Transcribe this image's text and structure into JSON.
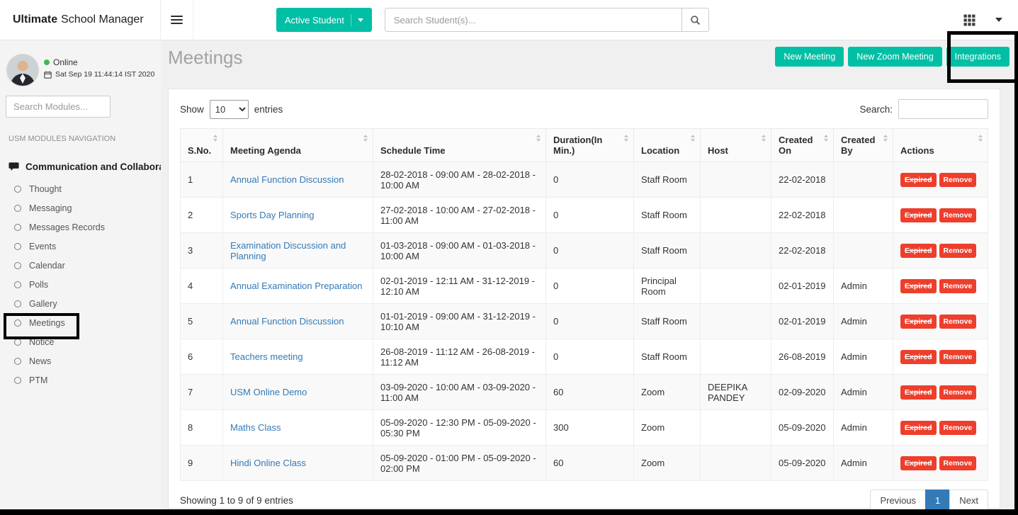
{
  "topbar": {
    "logo_bold": "Ultimate",
    "logo_rest": "School Manager",
    "student_filter_label": "Active Student",
    "search_placeholder": "Search Student(s)..."
  },
  "sidebar": {
    "status": "Online",
    "datetime": "Sat Sep 19 11:44:14 IST 2020",
    "search_placeholder": "Search Modules...",
    "nav_label": "USM MODULES NAVIGATION",
    "section_label": "Communication and Collaboration",
    "items": [
      {
        "label": "Thought"
      },
      {
        "label": "Messaging"
      },
      {
        "label": "Messages Records"
      },
      {
        "label": "Events"
      },
      {
        "label": "Calendar"
      },
      {
        "label": "Polls"
      },
      {
        "label": "Gallery"
      },
      {
        "label": "Meetings",
        "active": true
      },
      {
        "label": "Notice"
      },
      {
        "label": "News"
      },
      {
        "label": "PTM"
      }
    ]
  },
  "page": {
    "title": "Meetings",
    "buttons": [
      {
        "label": "New Meeting"
      },
      {
        "label": "New Zoom Meeting"
      },
      {
        "label": "Integrations"
      }
    ]
  },
  "table": {
    "show_label": "Show",
    "entries_label": "entries",
    "page_size": "10",
    "search_label": "Search:",
    "columns": [
      "S.No.",
      "Meeting Agenda",
      "Schedule Time",
      "Duration(In Min.)",
      "Location",
      "Host",
      "Created On",
      "Created By",
      "Actions"
    ],
    "rows": [
      {
        "sno": "1",
        "agenda": "Annual Function Discussion",
        "schedule": "28-02-2018 - 09:00 AM - 28-02-2018 - 10:00 AM",
        "duration": "0",
        "location": "Staff Room",
        "host": "",
        "created_on": "22-02-2018",
        "created_by": "",
        "actions": [
          "Expired",
          "Remove"
        ]
      },
      {
        "sno": "2",
        "agenda": "Sports Day Planning",
        "schedule": "27-02-2018 - 10:00 AM - 27-02-2018 - 11:00 AM",
        "duration": "0",
        "location": "Staff Room",
        "host": "",
        "created_on": "22-02-2018",
        "created_by": "",
        "actions": [
          "Expired",
          "Remove"
        ]
      },
      {
        "sno": "3",
        "agenda": "Examination Discussion and Planning",
        "schedule": "01-03-2018 - 09:00 AM - 01-03-2018 - 10:00 AM",
        "duration": "0",
        "location": "Staff Room",
        "host": "",
        "created_on": "22-02-2018",
        "created_by": "",
        "actions": [
          "Expired",
          "Remove"
        ]
      },
      {
        "sno": "4",
        "agenda": "Annual Examination Preparation",
        "schedule": "02-01-2019 - 12:11 AM - 31-12-2019 - 12:10 AM",
        "duration": "0",
        "location": "Principal Room",
        "host": "",
        "created_on": "02-01-2019",
        "created_by": "Admin",
        "actions": [
          "Expired",
          "Remove"
        ]
      },
      {
        "sno": "5",
        "agenda": "Annual Function Discussion",
        "schedule": "01-01-2019 - 09:00 AM - 31-12-2019 - 10:10 AM",
        "duration": "0",
        "location": "Staff Room",
        "host": "",
        "created_on": "02-01-2019",
        "created_by": "Admin",
        "actions": [
          "Expired",
          "Remove"
        ]
      },
      {
        "sno": "6",
        "agenda": "Teachers meeting",
        "schedule": "26-08-2019 - 11:12 AM - 26-08-2019 - 11:12 AM",
        "duration": "0",
        "location": "Staff Room",
        "host": "",
        "created_on": "26-08-2019",
        "created_by": "Admin",
        "actions": [
          "Expired",
          "Remove"
        ]
      },
      {
        "sno": "7",
        "agenda": "USM Online Demo",
        "schedule": "03-09-2020 - 10:00 AM - 03-09-2020 - 11:00 AM",
        "duration": "60",
        "location": "Zoom",
        "host": "DEEPIKA PANDEY",
        "created_on": "02-09-2020",
        "created_by": "Admin",
        "actions": [
          "Expired",
          "Remove"
        ]
      },
      {
        "sno": "8",
        "agenda": "Maths Class",
        "schedule": "05-09-2020 - 12:30 PM - 05-09-2020 - 05:30 PM",
        "duration": "300",
        "location": "Zoom",
        "host": "",
        "created_on": "05-09-2020",
        "created_by": "Admin",
        "actions": [
          "Expired",
          "Remove"
        ]
      },
      {
        "sno": "9",
        "agenda": "Hindi Online Class",
        "schedule": "05-09-2020 - 01:00 PM - 05-09-2020 - 02:00 PM",
        "duration": "60",
        "location": "Zoom",
        "host": "",
        "created_on": "05-09-2020",
        "created_by": "Admin",
        "actions": [
          "Expired",
          "Remove"
        ]
      }
    ],
    "footer": "Showing 1 to 9 of 9 entries",
    "pagination": {
      "previous": "Previous",
      "page": "1",
      "next": "Next"
    }
  },
  "colors": {
    "teal": "#00bfa5",
    "red": "#ee3e2c",
    "link_blue": "#337ab7",
    "active_page_blue": "#337ab7"
  }
}
